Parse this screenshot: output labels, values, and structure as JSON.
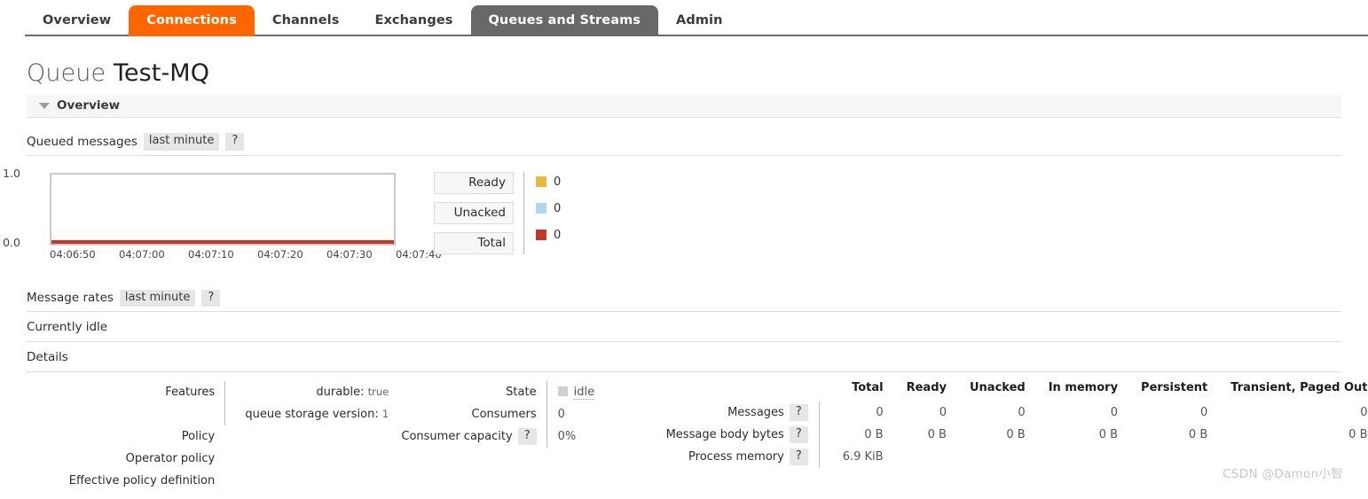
{
  "nav": {
    "tabs": [
      {
        "label": "Overview",
        "state": "normal"
      },
      {
        "label": "Connections",
        "state": "accent"
      },
      {
        "label": "Channels",
        "state": "normal"
      },
      {
        "label": "Exchanges",
        "state": "normal"
      },
      {
        "label": "Queues and Streams",
        "state": "current"
      },
      {
        "label": "Admin",
        "state": "normal"
      }
    ]
  },
  "page": {
    "title_kind": "Queue",
    "title_name": "Test-MQ",
    "section_overview": "Overview",
    "queued_messages_label": "Queued messages",
    "queued_messages_period": "last minute",
    "help": "?",
    "message_rates_label": "Message rates",
    "message_rates_period": "last minute",
    "currently_idle": "Currently idle",
    "details_label": "Details",
    "watermark": "CSDN @Damon小智"
  },
  "chart_data": {
    "type": "line",
    "title": "Queued messages",
    "xlabel": "",
    "ylabel": "",
    "ylim": [
      0.0,
      1.0
    ],
    "ytick_labels": [
      "1.0",
      "0.0"
    ],
    "grid": false,
    "legend_position": "right",
    "x": [
      "04:06:50",
      "04:07:00",
      "04:07:10",
      "04:07:20",
      "04:07:30",
      "04:07:40"
    ],
    "series": [
      {
        "name": "Ready",
        "color": "#e8b93a",
        "current": "0",
        "values": [
          0,
          0,
          0,
          0,
          0,
          0
        ]
      },
      {
        "name": "Unacked",
        "color": "#aed6f1",
        "current": "0",
        "values": [
          0,
          0,
          0,
          0,
          0,
          0
        ]
      },
      {
        "name": "Total",
        "color": "#c0392b",
        "current": "0",
        "values": [
          0,
          0,
          0,
          0,
          0,
          0
        ]
      }
    ]
  },
  "details": {
    "features": {
      "labels": [
        "Features",
        "",
        "Policy",
        "Operator policy",
        "Effective policy definition"
      ],
      "values": [
        {
          "key": "durable:",
          "val": "true"
        },
        {
          "key": "queue storage version:",
          "val": "1"
        }
      ]
    },
    "state": {
      "rows": [
        {
          "label": "State",
          "help": "",
          "value": "idle",
          "icon": "state-square-icon"
        },
        {
          "label": "Consumers",
          "help": "",
          "value": "0",
          "icon": ""
        },
        {
          "label": "Consumer capacity",
          "help": "?",
          "value": "0%",
          "icon": ""
        }
      ]
    },
    "stats": {
      "columns": [
        "",
        "Total",
        "Ready",
        "Unacked",
        "In memory",
        "Persistent",
        "Transient, Paged Out"
      ],
      "rows": [
        {
          "label": "Messages",
          "help": "?",
          "cells": [
            "0",
            "0",
            "0",
            "0",
            "0",
            "0"
          ]
        },
        {
          "label": "Message body bytes",
          "help": "?",
          "cells": [
            "0 B",
            "0 B",
            "0 B",
            "0 B",
            "0 B",
            "0 B"
          ]
        },
        {
          "label": "Process memory",
          "help": "?",
          "cells": [
            "6.9 KiB",
            "",
            "",
            "",
            "",
            ""
          ]
        }
      ]
    }
  }
}
